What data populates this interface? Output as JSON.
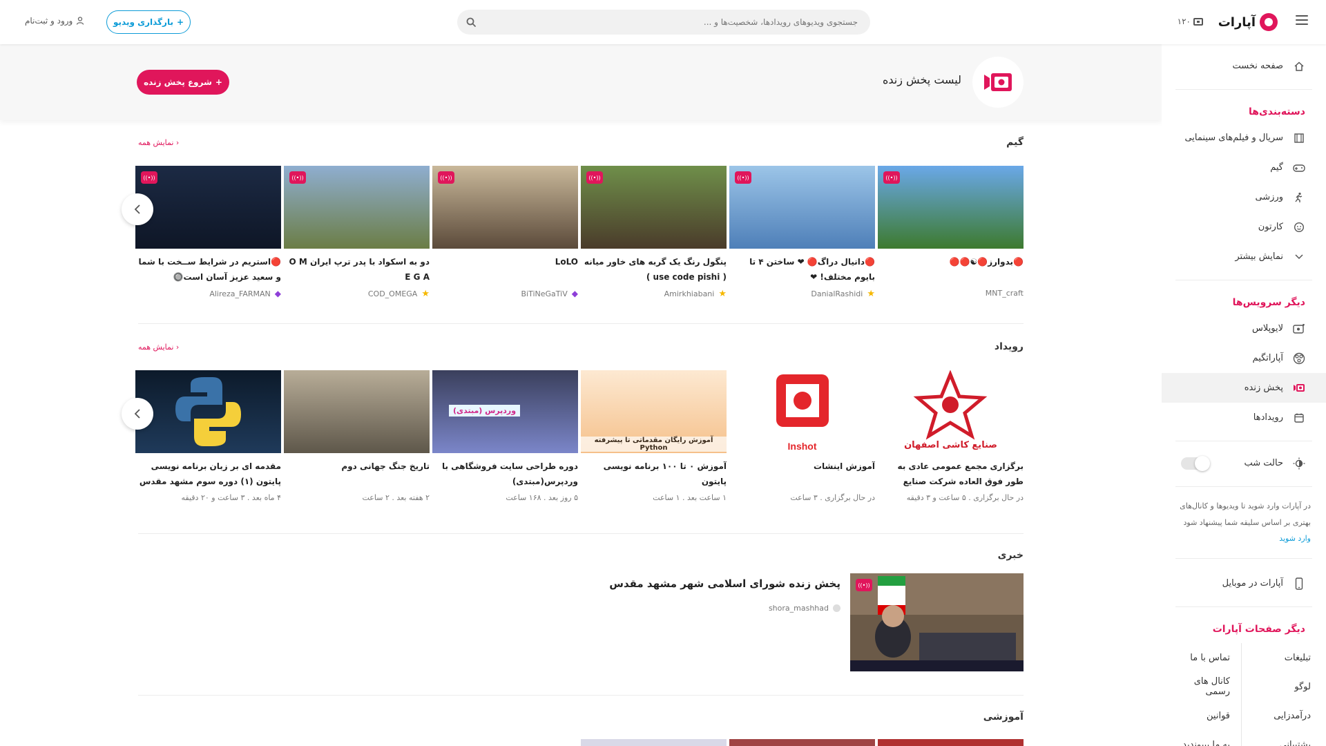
{
  "header": {
    "logo_text": "آپارات",
    "live_count": "۱۲۰",
    "search_placeholder": "جستجوی ویدیوهای رویدادها، شخصیت‌ها و ...",
    "upload_label": "بارگذاری ویدیو",
    "login_label": "ورود و ثبت‌نام"
  },
  "band": {
    "title": "لیست پخش زنده",
    "start_live_label": "شروع پخش زنده"
  },
  "sidebar": {
    "home": "صفحه نخست",
    "categories_heading": "دسته‌بندی‌ها",
    "categories": [
      "سریال و فیلم‌های سینمایی",
      "گیم",
      "ورزشی",
      "کارتون",
      "نمایش بیشتر"
    ],
    "services_heading": "دیگر سرویس‌ها",
    "services": [
      "لایوپلاس",
      "آپاراتگیم",
      "پخش زنده",
      "رویدادها"
    ],
    "night_mode": "حالت شب",
    "note": "در آپارات وارد شوید تا ویدیوها و کانال‌های بهتری بر اساس سلیقه شما پیشنهاد شود",
    "login_link": "وارد شوید",
    "mobile": "آپارات در موبایل",
    "pages_heading": "دیگر صفحات آپارات",
    "pages_col1": [
      "تبلیغات",
      "لوگو",
      "درآمدزایی",
      "پشتیبانی"
    ],
    "pages_col2": [
      "تماس با ما",
      "کانال های رسمی",
      "قوانین",
      "به ما بپیوندید"
    ]
  },
  "sections": {
    "show_all": "نمایش همه",
    "game": {
      "title": "گیم",
      "cards": [
        {
          "title": "🔴بدوارز🔴☯🔴🔴",
          "meta": "MNT_craft",
          "badge": "none",
          "colors": [
            "#6aa8e8",
            "#3d7a2e"
          ]
        },
        {
          "title": "🔴دانیال دراگ🔴 ❤ ساختن ۴ تا بایوم مختلف! ❤",
          "meta": "DanialRashidi",
          "badge": "star",
          "colors": [
            "#9cc5e8",
            "#4e7fb8"
          ]
        },
        {
          "title": "پنگول رنگ یک گربه های خاور میانه ( use code pishi )",
          "meta": "Amirkhiabani",
          "badge": "star",
          "colors": [
            "#6f8f4a",
            "#4a3b2a"
          ]
        },
        {
          "title": "LoLO",
          "meta": "BiTiNeGaTiV",
          "badge": "diamond",
          "colors": [
            "#c9b89a",
            "#5b4a3a"
          ]
        },
        {
          "title": "دو به اسکواد با پدر ترپ ایران O M E G A",
          "meta": "COD_OMEGA",
          "badge": "star",
          "colors": [
            "#8faed0",
            "#6b7d45"
          ]
        },
        {
          "title": "🔴استریم در شرایط ســخت با شما و سعید عزیز آسان است🔘",
          "meta": "Alireza_FARMAN",
          "badge": "diamond",
          "colors": [
            "#1c2a44",
            "#0e1626"
          ]
        }
      ]
    },
    "event": {
      "title": "رویداد",
      "cards": [
        {
          "title": "برگزاری مجمع عمومی عادی به طور فوق العاده شرکت صنایع کاشی",
          "meta": "در حال برگزاری  .  ۵ ساعت و ۳ دقیقه",
          "colors": [
            "#ffffff",
            "#ffffff"
          ]
        },
        {
          "title": "آموزش اینشات",
          "meta": "در حال برگزاری  .  ۳ ساعت",
          "colors": [
            "#ffffff",
            "#ffffff"
          ]
        },
        {
          "title": "آموزش ۰ تا ۱۰۰ برنامه نویسی پایتون",
          "meta": "۱ ساعت بعد  .  ۱ ساعت",
          "colors": [
            "#fde9d2",
            "#f5c08a"
          ]
        },
        {
          "title": "دوره طراحی سایت فروشگاهی با وردپرس(مبتدی)",
          "meta": "۵ روز بعد  .  ۱۶۸ ساعت",
          "colors": [
            "#3a3f5c",
            "#7b86c9"
          ]
        },
        {
          "title": "تاریخ جنگ جهانی دوم",
          "meta": "۲ هفته بعد  .  ۲ ساعت",
          "colors": [
            "#b8ad98",
            "#5e574a"
          ]
        },
        {
          "title": "مقدمه ای بر زبان برنامه نویسی پایتون (۱) دوره سوم مشهد مقدس",
          "meta": "۴ ماه بعد  .  ۳ ساعت و ۲۰ دقیقه",
          "colors": [
            "#0c1a2a",
            "#1f3a5a"
          ]
        }
      ],
      "inshot_label": "Inshot",
      "tile_logo_text": "صنایع کاشی اصفهان",
      "python_banner": "آموزش رایگان مقدماتی تا پیشرفته Python",
      "wp_banner": "وردپرس (مبتدی)"
    },
    "news": {
      "title": "خبری",
      "card_title": "پخش زنده شورای اسلامی شهر مشهد مقدس",
      "card_meta": "shora_mashhad"
    },
    "education": {
      "title": "آموزشی"
    }
  },
  "colors": {
    "brand": "#e0165b",
    "accent_blue": "#0b9bd7"
  }
}
